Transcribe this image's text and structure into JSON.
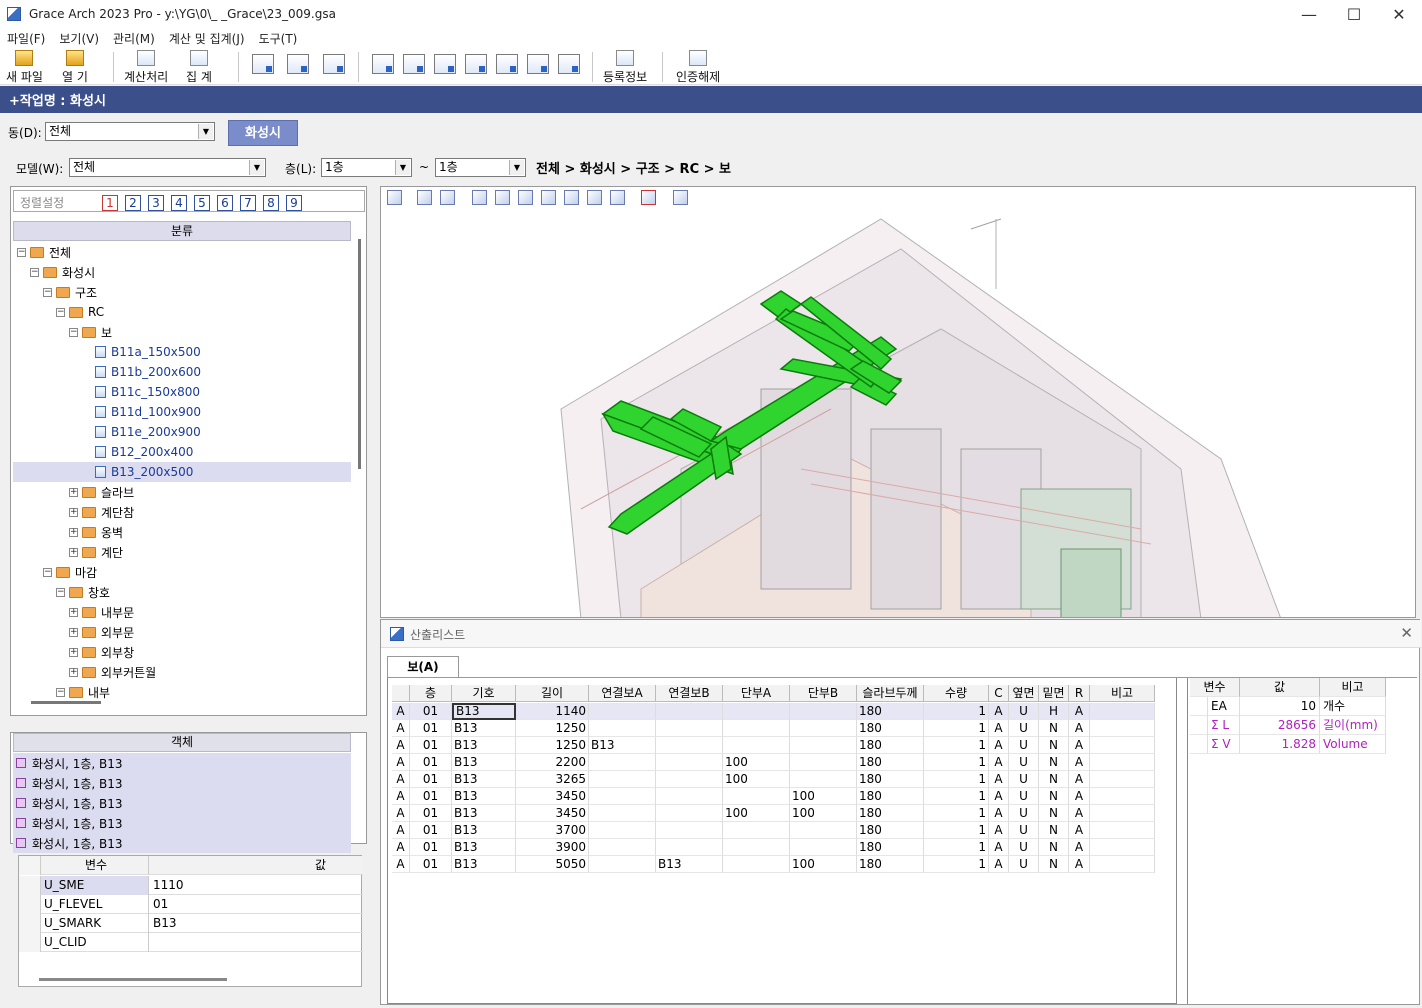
{
  "window": {
    "title": "Grace Arch 2023 Pro - y:\\YG\\0\\_                                    _Grace\\23_009.gsa",
    "minimize": "—",
    "maximize": "☐",
    "close": "✕"
  },
  "menu": [
    "파일(F)",
    "보기(V)",
    "관리(M)",
    "계산 및 집계(J)",
    "도구(T)"
  ],
  "toolbar": {
    "new_file": "새 파일",
    "open": "열  기",
    "calc": "계산처리",
    "sum": "집  계",
    "register": "등록정보",
    "auth_release": "인증해제"
  },
  "job": {
    "label": "+작업명 : 화성시"
  },
  "dong": {
    "label": "동(D):",
    "value": "전체",
    "tab": "화성시"
  },
  "filter": {
    "model_label": "모델(W):",
    "model_value": "전체",
    "floor_label": "층(L):",
    "floor_from": "1층",
    "tilde": "~",
    "floor_to": "1층",
    "breadcrumb": "전체 > 화성시 > 구조 > RC > 보"
  },
  "tree": {
    "sort_label": "정렬설정",
    "sort_numbers": [
      "1",
      "2",
      "3",
      "4",
      "5",
      "6",
      "7",
      "8",
      "9"
    ],
    "header": "분류",
    "nodes": [
      {
        "label": "전체",
        "level": 0,
        "type": "folder",
        "exp": "−"
      },
      {
        "label": "화성시",
        "level": 1,
        "type": "folder",
        "exp": "−"
      },
      {
        "label": "구조",
        "level": 2,
        "type": "folder",
        "exp": "−"
      },
      {
        "label": "RC",
        "level": 3,
        "type": "folder",
        "exp": "−"
      },
      {
        "label": "보",
        "level": 4,
        "type": "folder",
        "exp": "−"
      },
      {
        "label": "B11a_150x500",
        "level": 5,
        "type": "file"
      },
      {
        "label": "B11b_200x600",
        "level": 5,
        "type": "file"
      },
      {
        "label": "B11c_150x800",
        "level": 5,
        "type": "file"
      },
      {
        "label": "B11d_100x900",
        "level": 5,
        "type": "file"
      },
      {
        "label": "B11e_200x900",
        "level": 5,
        "type": "file"
      },
      {
        "label": "B12_200x400",
        "level": 5,
        "type": "file"
      },
      {
        "label": "B13_200x500",
        "level": 5,
        "type": "file",
        "selected": true
      },
      {
        "label": "슬라브",
        "level": 4,
        "type": "folder",
        "exp": "+"
      },
      {
        "label": "계단참",
        "level": 4,
        "type": "folder",
        "exp": "+"
      },
      {
        "label": "옹벽",
        "level": 4,
        "type": "folder",
        "exp": "+"
      },
      {
        "label": "계단",
        "level": 4,
        "type": "folder",
        "exp": "+"
      },
      {
        "label": "마감",
        "level": 2,
        "type": "folder",
        "exp": "−"
      },
      {
        "label": "창호",
        "level": 3,
        "type": "folder",
        "exp": "−"
      },
      {
        "label": "내부문",
        "level": 4,
        "type": "folder",
        "exp": "+"
      },
      {
        "label": "외부문",
        "level": 4,
        "type": "folder",
        "exp": "+"
      },
      {
        "label": "외부창",
        "level": 4,
        "type": "folder",
        "exp": "+"
      },
      {
        "label": "외부커튼월",
        "level": 4,
        "type": "folder",
        "exp": "+"
      },
      {
        "label": "내부",
        "level": 3,
        "type": "folder",
        "exp": "−"
      }
    ]
  },
  "objects": {
    "header": "객체",
    "items": [
      "화성시, 1층, B13",
      "화성시, 1층, B13",
      "화성시, 1층, B13",
      "화성시, 1층, B13",
      "화성시, 1층, B13"
    ]
  },
  "props": {
    "col_var": "변수",
    "col_val": "값",
    "rows": [
      {
        "name": "U_SME",
        "value": "1110",
        "selected": true
      },
      {
        "name": "U_FLEVEL",
        "value": "01"
      },
      {
        "name": "U_SMARK",
        "value": "B13"
      },
      {
        "name": "U_CLID",
        "value": ""
      }
    ]
  },
  "result": {
    "title": "산출리스트",
    "tab": "보(A)",
    "columns": [
      "",
      "층",
      "기호",
      "길이",
      "연결보A",
      "연결보B",
      "단부A",
      "단부B",
      "슬라브두께",
      "수량",
      "C",
      "옆면",
      "밑면",
      "R",
      "비고"
    ],
    "rows": [
      [
        "A",
        "01",
        "B13",
        "1140",
        "",
        "",
        "",
        "",
        "180",
        "1",
        "A",
        "U",
        "H",
        "A",
        ""
      ],
      [
        "A",
        "01",
        "B13",
        "1250",
        "",
        "",
        "",
        "",
        "180",
        "1",
        "A",
        "U",
        "N",
        "A",
        ""
      ],
      [
        "A",
        "01",
        "B13",
        "1250",
        "B13",
        "",
        "",
        "",
        "180",
        "1",
        "A",
        "U",
        "N",
        "A",
        ""
      ],
      [
        "A",
        "01",
        "B13",
        "2200",
        "",
        "",
        "100",
        "",
        "180",
        "1",
        "A",
        "U",
        "N",
        "A",
        ""
      ],
      [
        "A",
        "01",
        "B13",
        "3265",
        "",
        "",
        "100",
        "",
        "180",
        "1",
        "A",
        "U",
        "N",
        "A",
        ""
      ],
      [
        "A",
        "01",
        "B13",
        "3450",
        "",
        "",
        "",
        "100",
        "180",
        "1",
        "A",
        "U",
        "N",
        "A",
        ""
      ],
      [
        "A",
        "01",
        "B13",
        "3450",
        "",
        "",
        "100",
        "100",
        "180",
        "1",
        "A",
        "U",
        "N",
        "A",
        ""
      ],
      [
        "A",
        "01",
        "B13",
        "3700",
        "",
        "",
        "",
        "",
        "180",
        "1",
        "A",
        "U",
        "N",
        "A",
        ""
      ],
      [
        "A",
        "01",
        "B13",
        "3900",
        "",
        "",
        "",
        "",
        "180",
        "1",
        "A",
        "U",
        "N",
        "A",
        ""
      ],
      [
        "A",
        "01",
        "B13",
        "5050",
        "",
        "B13",
        "",
        "100",
        "180",
        "1",
        "A",
        "U",
        "N",
        "A",
        ""
      ]
    ],
    "summary": {
      "columns": [
        "변수",
        "값",
        "비고"
      ],
      "rows": [
        {
          "sym": "EA",
          "val": "10",
          "note": "개수"
        },
        {
          "sym": "Σ L",
          "val": "28656",
          "note": "길이(mm)"
        },
        {
          "sym": "Σ V",
          "val": "1.828",
          "note": "Volume"
        }
      ]
    }
  }
}
